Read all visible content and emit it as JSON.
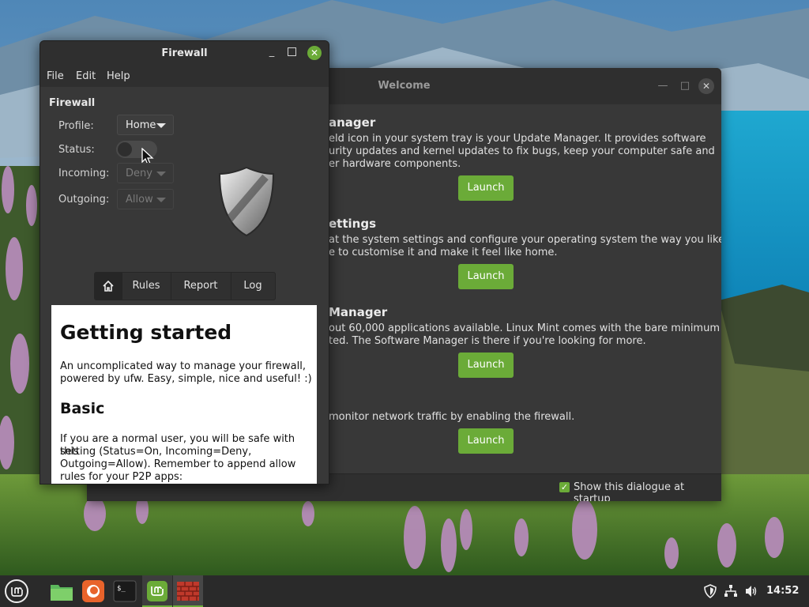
{
  "welcome_window": {
    "title": "Welcome",
    "sections": [
      {
        "title": "anager",
        "lines": [
          "eld icon in your system tray is your Update Manager. It provides software",
          "urity updates and kernel updates to fix bugs, keep your computer safe and",
          "er hardware components."
        ],
        "button": "Launch"
      },
      {
        "title": "ettings",
        "lines": [
          "at the system settings and configure your operating system the way you like.",
          "e to customise it and make it feel like home."
        ],
        "button": "Launch"
      },
      {
        "title": "Manager",
        "lines": [
          "out 60,000 applications available. Linux Mint comes with the bare minimum to",
          "ted. The Software Manager is there if you're looking for more."
        ],
        "button": "Launch"
      },
      {
        "title": "",
        "lines": [
          "monitor network traffic by enabling the firewall."
        ],
        "button": "Launch"
      }
    ],
    "show_at_startup_label": "Show this dialogue at startup",
    "show_at_startup_checked": true
  },
  "firewall_window": {
    "title": "Firewall",
    "menu": [
      "File",
      "Edit",
      "Help"
    ],
    "heading": "Firewall",
    "profile_label": "Profile:",
    "profile_value": "Home",
    "status_label": "Status:",
    "status_on": false,
    "incoming_label": "Incoming:",
    "incoming_value": "Deny",
    "outgoing_label": "Outgoing:",
    "outgoing_value": "Allow",
    "tabs": [
      "Rules",
      "Report",
      "Log"
    ],
    "doc": {
      "h1": "Getting started",
      "intro_lines": [
        "An uncomplicated way to manage your firewall,",
        "powered by ufw. Easy, simple, nice and useful! :)"
      ],
      "h2": "Basic",
      "basic_lines": [
        "If you are a normal user, you will be safe with this",
        "setting (Status=On, Incoming=Deny,",
        "Outgoing=Allow). Remember to append allow",
        "rules for your P2P apps:"
      ]
    }
  },
  "taskbar": {
    "apps": [
      "menu-icon",
      "files-icon",
      "firefox-icon",
      "terminal-icon",
      "mintinstall-icon",
      "firewall-icon"
    ],
    "tray": [
      "shield-icon",
      "network-icon",
      "volume-icon"
    ],
    "clock": "14:52"
  },
  "colors": {
    "accent": "#6bab38",
    "window_bg": "#383838",
    "titlebar_bg": "#2f2f2f",
    "taskbar_bg": "#2a2a2a"
  }
}
